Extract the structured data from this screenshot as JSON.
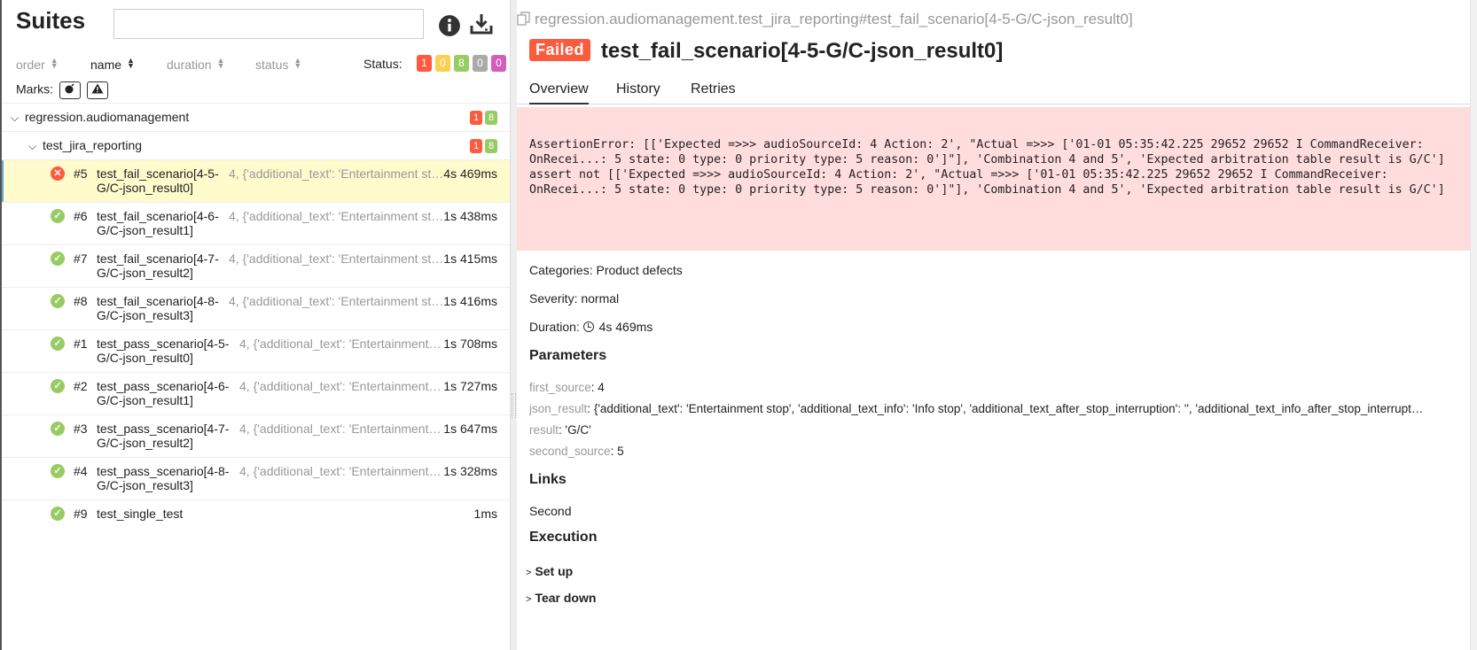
{
  "left": {
    "title": "Suites",
    "search": {
      "value": "",
      "placeholder": ""
    },
    "sort": [
      {
        "label": "order"
      },
      {
        "label": "name"
      },
      {
        "label": "duration"
      },
      {
        "label": "status"
      }
    ],
    "status_label": "Status:",
    "status_counts": {
      "failed": "1",
      "broken": "0",
      "passed": "8",
      "skipped": "0",
      "unknown": "0"
    },
    "marks_label": "Marks:",
    "groups": [
      {
        "name": "regression.audiomanagement",
        "failed": "1",
        "passed": "8"
      },
      {
        "name": "test_jira_reporting",
        "failed": "1",
        "passed": "8"
      }
    ],
    "tests": [
      {
        "order": "#5",
        "name": "test_fail_scenario[4-5-G/C-json_result0]",
        "params": "4, {'additional_text': 'Entertainment st…",
        "duration": "4s 469ms",
        "status": "failed"
      },
      {
        "order": "#6",
        "name": "test_fail_scenario[4-6-G/C-json_result1]",
        "params": "4, {'additional_text': 'Entertainment st…",
        "duration": "1s 438ms",
        "status": "passed"
      },
      {
        "order": "#7",
        "name": "test_fail_scenario[4-7-G/C-json_result2]",
        "params": "4, {'additional_text': 'Entertainment st…",
        "duration": "1s 415ms",
        "status": "passed"
      },
      {
        "order": "#8",
        "name": "test_fail_scenario[4-8-G/C-json_result3]",
        "params": "4, {'additional_text': 'Entertainment st…",
        "duration": "1s 416ms",
        "status": "passed"
      },
      {
        "order": "#1",
        "name": "test_pass_scenario[4-5-G/C-json_result0]",
        "params": "4, {'additional_text': 'Entertainment…",
        "duration": "1s 708ms",
        "status": "passed"
      },
      {
        "order": "#2",
        "name": "test_pass_scenario[4-6-G/C-json_result1]",
        "params": "4, {'additional_text': 'Entertainment…",
        "duration": "1s 727ms",
        "status": "passed"
      },
      {
        "order": "#3",
        "name": "test_pass_scenario[4-7-G/C-json_result2]",
        "params": "4, {'additional_text': 'Entertainment…",
        "duration": "1s 647ms",
        "status": "passed"
      },
      {
        "order": "#4",
        "name": "test_pass_scenario[4-8-G/C-json_result3]",
        "params": "4, {'additional_text': 'Entertainment…",
        "duration": "1s 328ms",
        "status": "passed"
      },
      {
        "order": "#9",
        "name": "test_single_test",
        "params": "",
        "duration": "1ms",
        "status": "passed"
      }
    ]
  },
  "right": {
    "breadcrumb": "regression.audiomanagement.test_jira_reporting#test_fail_scenario[4-5-G/C-json_result0]",
    "status": "Failed",
    "title": "test_fail_scenario[4-5-G/C-json_result0]",
    "tabs": [
      "Overview",
      "History",
      "Retries"
    ],
    "error_lines": [
      "AssertionError: [['Expected =>>> audioSourceId: 4 Action: 2', \"Actual =>>> ['01-01 05:35:42.225 29652 29652 I CommandReceiver: OnRecei...: 5 state: 0 type: 0 priority type: 5 reason: 0']\"], 'Combination 4 and 5', 'Expected arbitration table result is G/C']",
      "assert not [['Expected =>>> audioSourceId: 4 Action: 2', \"Actual =>>> ['01-01 05:35:42.225 29652 29652 I CommandReceiver: OnRecei...: 5 state: 0 type: 0 priority type: 5 reason: 0']\"], 'Combination 4 and 5', 'Expected arbitration table result is G/C']"
    ],
    "categories_label": "Categories:",
    "categories_value": "Product defects",
    "severity_label": "Severity:",
    "severity_value": "normal",
    "duration_label": "Duration:",
    "duration_value": "4s 469ms",
    "parameters_heading": "Parameters",
    "parameters": [
      {
        "key": "first_source",
        "value": "4"
      },
      {
        "key": "json_result",
        "value": "{'additional_text': 'Entertainment stop', 'additional_text_info': 'Info stop', 'additional_text_after_stop_interruption': '', 'additional_text_info_after_stop_interrupt…"
      },
      {
        "key": "result",
        "value": "'G/C'"
      },
      {
        "key": "second_source",
        "value": "5"
      }
    ],
    "links_heading": "Links",
    "links": [
      "Second"
    ],
    "execution_heading": "Execution",
    "execution_steps": [
      "Set up",
      "Tear down"
    ]
  }
}
